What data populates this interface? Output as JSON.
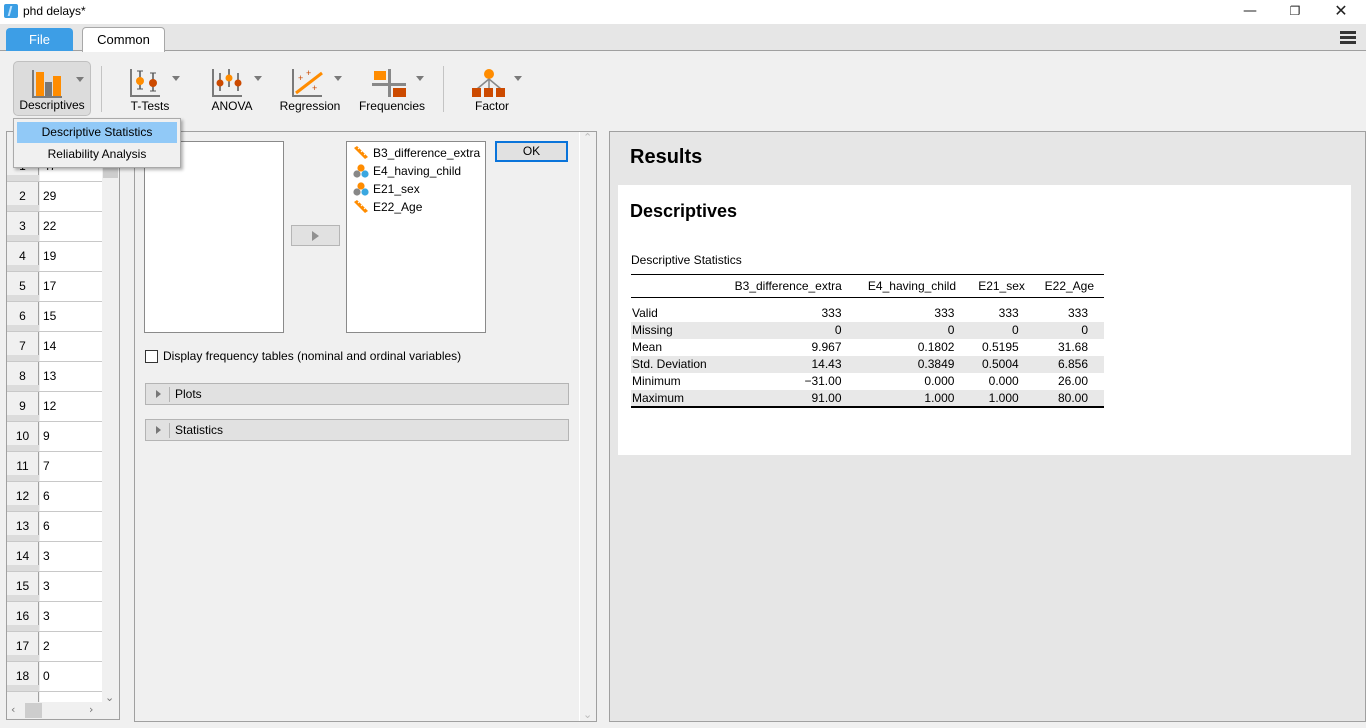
{
  "window": {
    "title": "phd delays*",
    "controls": {
      "minimize": "—",
      "maximize": "❐",
      "close": "✕"
    }
  },
  "ribbon": {
    "tabs": [
      {
        "label": "File",
        "style": "file"
      },
      {
        "label": "Common",
        "active": true
      }
    ],
    "menu_icon": "hamburger-list-icon"
  },
  "toolbar": {
    "items": [
      {
        "label": "Descriptives",
        "icon": "bar-chart-icon",
        "active": true
      },
      {
        "label": "T-Tests",
        "icon": "t-test-icon"
      },
      {
        "label": "ANOVA",
        "icon": "anova-icon"
      },
      {
        "label": "Regression",
        "icon": "regression-icon"
      },
      {
        "label": "Frequencies",
        "icon": "frequencies-icon"
      },
      {
        "label": "Factor",
        "icon": "factor-icon"
      }
    ]
  },
  "dropdown": {
    "items": [
      {
        "label": "Descriptive Statistics",
        "selected": true
      },
      {
        "label": "Reliability Analysis"
      }
    ]
  },
  "grid": {
    "rows": [
      {
        "n": "1",
        "value": "47"
      },
      {
        "n": "2",
        "value": "29"
      },
      {
        "n": "3",
        "value": "22"
      },
      {
        "n": "4",
        "value": "19"
      },
      {
        "n": "5",
        "value": "17"
      },
      {
        "n": "6",
        "value": "15"
      },
      {
        "n": "7",
        "value": "14"
      },
      {
        "n": "8",
        "value": "13"
      },
      {
        "n": "9",
        "value": "12"
      },
      {
        "n": "10",
        "value": "9"
      },
      {
        "n": "11",
        "value": "7"
      },
      {
        "n": "12",
        "value": "6"
      },
      {
        "n": "13",
        "value": "6"
      },
      {
        "n": "14",
        "value": "3"
      },
      {
        "n": "15",
        "value": "3"
      },
      {
        "n": "16",
        "value": "3"
      },
      {
        "n": "17",
        "value": "2"
      },
      {
        "n": "18",
        "value": "0"
      }
    ]
  },
  "analysis": {
    "source_variables": [],
    "selected_variables": [
      {
        "name": "B3_difference_extra",
        "type": "scale"
      },
      {
        "name": "E4_having_child",
        "type": "nominal"
      },
      {
        "name": "E21_sex",
        "type": "nominal"
      },
      {
        "name": "E22_Age",
        "type": "scale"
      }
    ],
    "ok_label": "OK",
    "checkbox_label": "Display frequency tables (nominal and ordinal variables)",
    "checkbox_checked": false,
    "sections": [
      {
        "label": "Plots"
      },
      {
        "label": "Statistics"
      }
    ]
  },
  "results": {
    "title": "Results",
    "analysis_title": "Descriptives",
    "table_caption": "Descriptive Statistics",
    "columns": [
      "",
      "B3_difference_extra",
      "E4_having_child",
      "E21_sex",
      "E22_Age"
    ],
    "rows": [
      {
        "label": "Valid",
        "values": [
          "333",
          "333",
          "333",
          "333"
        ]
      },
      {
        "label": "Missing",
        "values": [
          "0",
          "0",
          "0",
          "0"
        ]
      },
      {
        "label": "Mean",
        "values": [
          "9.967",
          "0.1802",
          "0.5195",
          "31.68"
        ]
      },
      {
        "label": "Std. Deviation",
        "values": [
          "14.43",
          "0.3849",
          "0.5004",
          "6.856"
        ]
      },
      {
        "label": "Minimum",
        "values": [
          "−31.00",
          "0.000",
          "0.000",
          "26.00"
        ]
      },
      {
        "label": "Maximum",
        "values": [
          "91.00",
          "1.000",
          "1.000",
          "80.00"
        ]
      }
    ]
  },
  "colors": {
    "accent_blue": "#3d9ee6",
    "menu_selected": "#91c9f7",
    "icon_orange": "#ff8c00",
    "icon_dark_orange": "#cc4a00",
    "ok_focus": "#0a74da"
  }
}
